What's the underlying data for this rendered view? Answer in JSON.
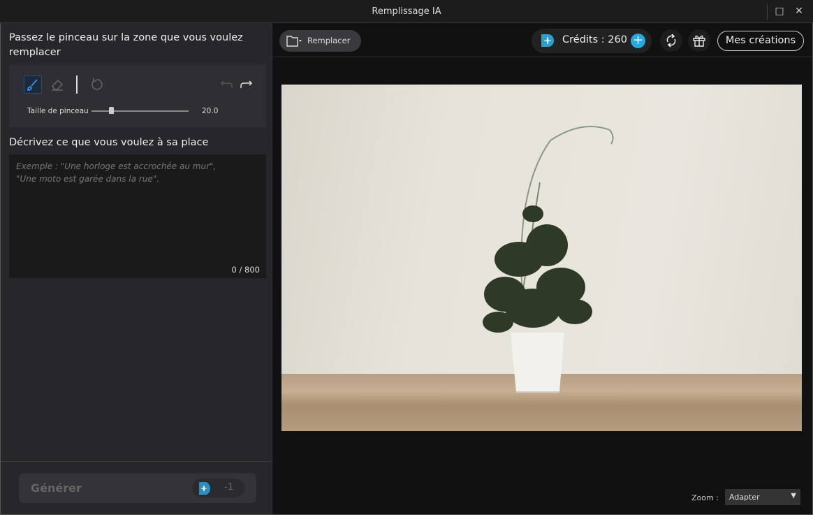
{
  "window": {
    "title": "Remplissage IA",
    "maximize_icon": "□",
    "close_icon": "✕"
  },
  "left": {
    "brush_heading": "Passez le pinceau sur la zone que vous voulez remplacer",
    "brush_size_label": "Taille de pinceau",
    "brush_size_value": "20.0",
    "brush_size_fraction": 0.2,
    "describe_heading": "Décrivez ce que vous voulez à sa place",
    "placeholder_line1": "Exemple : \"Une horloge est accrochée au mur\",",
    "placeholder_line2": "\"Une moto est garée dans la rue\".",
    "char_count": "0 / 800",
    "generate_label": "Générer",
    "generate_cost": "-1"
  },
  "toolbar": {
    "replace_label": "Remplacer",
    "credits_label": "Crédits : 260",
    "my_creations_label": "Mes créations"
  },
  "footer": {
    "zoom_label": "Zoom :",
    "zoom_value": "Adapter"
  },
  "colors": {
    "accent": "#29a8e0",
    "panel": "#26262b"
  }
}
